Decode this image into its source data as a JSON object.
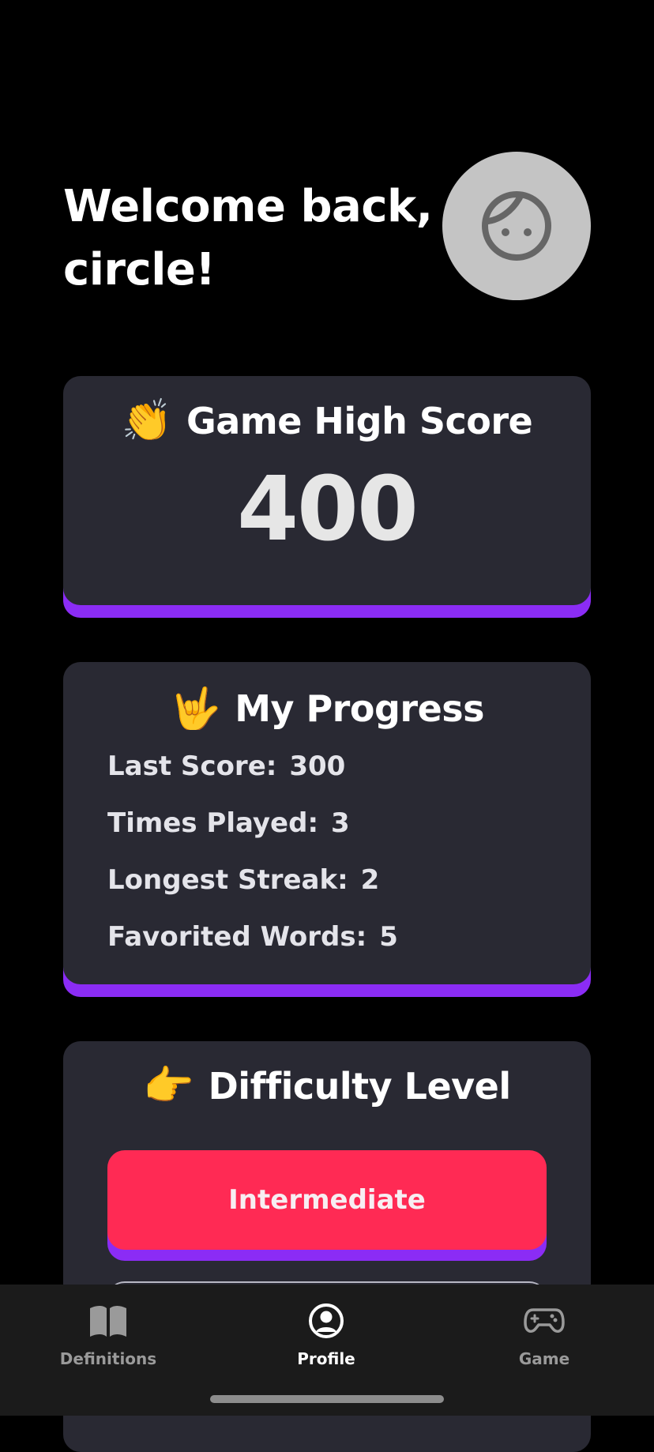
{
  "greeting": {
    "line1": "Welcome back,",
    "line2": "circle!"
  },
  "avatar": {
    "icon": "face-icon"
  },
  "high_score": {
    "emoji": "👏",
    "title": "Game High Score",
    "value": "400"
  },
  "progress": {
    "emoji": "🤟",
    "title": "My Progress",
    "stats": [
      {
        "label": "Last Score:",
        "value": "300"
      },
      {
        "label": "Times Played:",
        "value": "3"
      },
      {
        "label": "Longest Streak:",
        "value": "2"
      },
      {
        "label": "Favorited Words:",
        "value": "5"
      }
    ]
  },
  "difficulty": {
    "emoji": "👉",
    "title": "Difficulty Level",
    "selected_option": "Intermediate"
  },
  "tabbar": {
    "tabs": [
      {
        "label": "Definitions",
        "icon": "book-icon",
        "active": false
      },
      {
        "label": "Profile",
        "icon": "profile-icon",
        "active": true
      },
      {
        "label": "Game",
        "icon": "gamepad-icon",
        "active": false
      }
    ]
  },
  "colors": {
    "background": "#000000",
    "card": "#292933",
    "accent_purple": "#8b2cf5",
    "button_red": "#ff2a54",
    "avatar_gray": "#c4c4c4"
  }
}
